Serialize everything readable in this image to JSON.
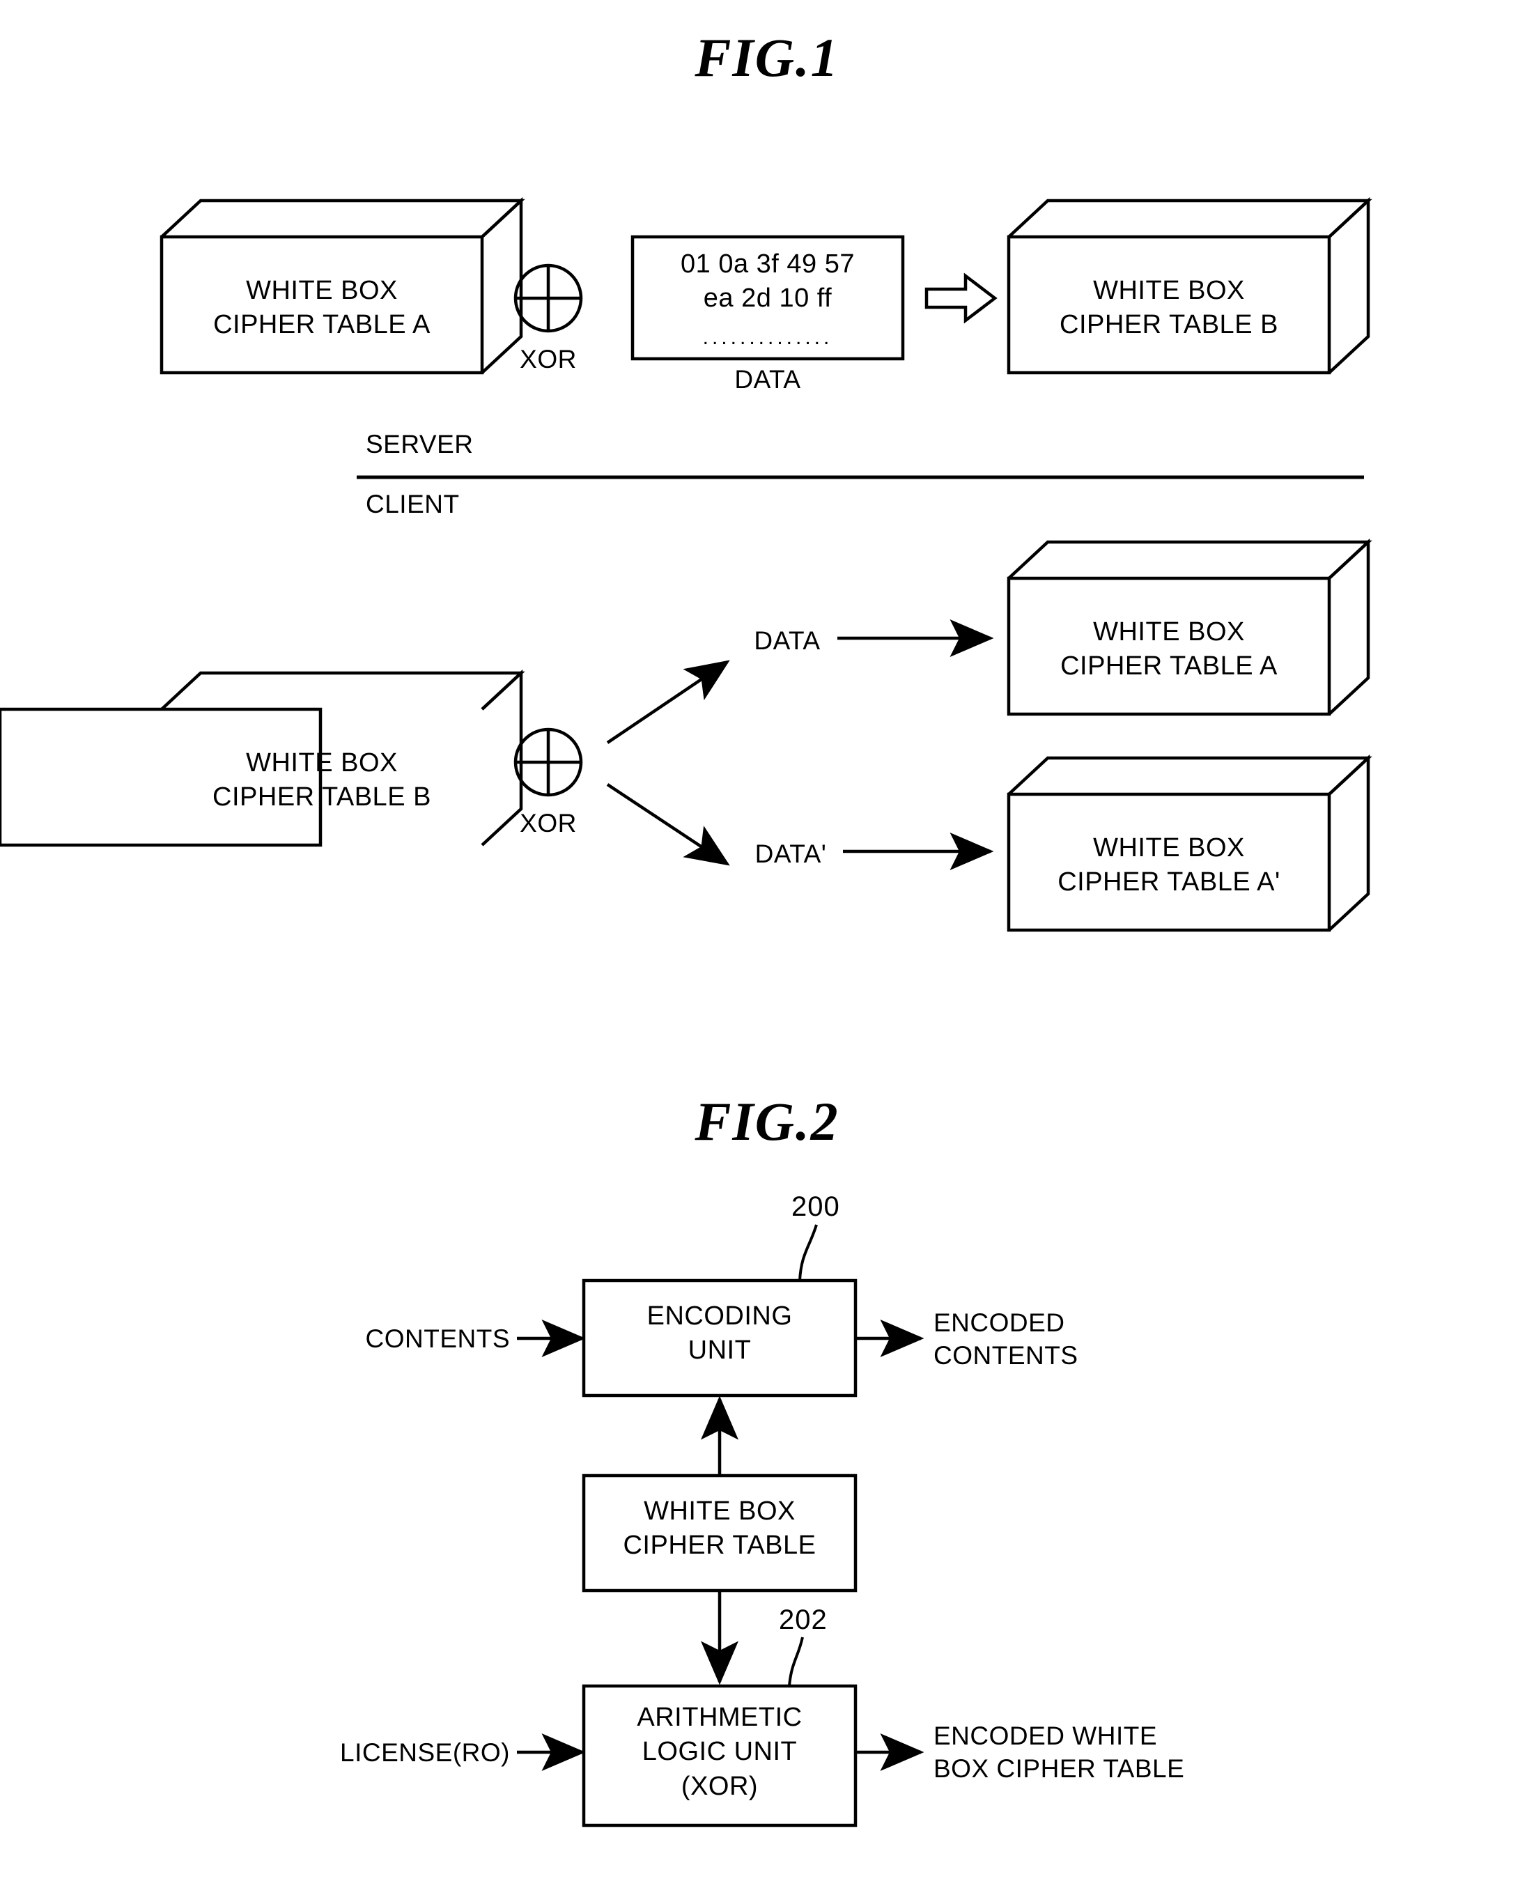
{
  "figures": [
    {
      "id": "fig1",
      "title": "FIG.1",
      "server_label": "SERVER",
      "client_label": "CLIENT",
      "server_row": {
        "cube_left_line1": "WHITE BOX",
        "cube_left_line2": "CIPHER TABLE A",
        "operator_symbol": "xor-circle-icon",
        "operator_label": "XOR",
        "data_box_line1": "01 0a 3f 49 57",
        "data_box_line2": "ea 2d 10 ff",
        "data_box_line3": "..............",
        "data_box_caption": "DATA",
        "transform_arrow": "block-arrow-right-icon",
        "cube_right_line1": "WHITE BOX",
        "cube_right_line2": "CIPHER TABLE B"
      },
      "client_row": {
        "cube_source_line1": "WHITE BOX",
        "cube_source_line2": "CIPHER TABLE B",
        "operator_symbol": "xor-circle-icon",
        "operator_label": "XOR",
        "branch_top_label": "DATA",
        "branch_bottom_label": "DATA'",
        "cube_top_line1": "WHITE BOX",
        "cube_top_line2": "CIPHER TABLE A",
        "cube_bottom_line1": "WHITE BOX",
        "cube_bottom_line2": "CIPHER TABLE A'"
      }
    },
    {
      "id": "fig2",
      "title": "FIG.2",
      "blocks": [
        {
          "ref": "200",
          "line1": "ENCODING",
          "line2": "UNIT",
          "line3": ""
        },
        {
          "ref": "",
          "line1": "WHITE BOX",
          "line2": "CIPHER TABLE",
          "line3": ""
        },
        {
          "ref": "202",
          "line1": "ARITHMETIC",
          "line2": "LOGIC UNIT",
          "line3": "(XOR)"
        }
      ],
      "io_labels": {
        "input_top": "CONTENTS",
        "output_top_line1": "ENCODED",
        "output_top_line2": "CONTENTS",
        "input_bottom": "LICENSE(RO)",
        "output_bottom_line1": "ENCODED WHITE",
        "output_bottom_line2": "BOX CIPHER TABLE"
      }
    }
  ],
  "colors": {
    "ink": "#000000",
    "paper": "#ffffff"
  }
}
